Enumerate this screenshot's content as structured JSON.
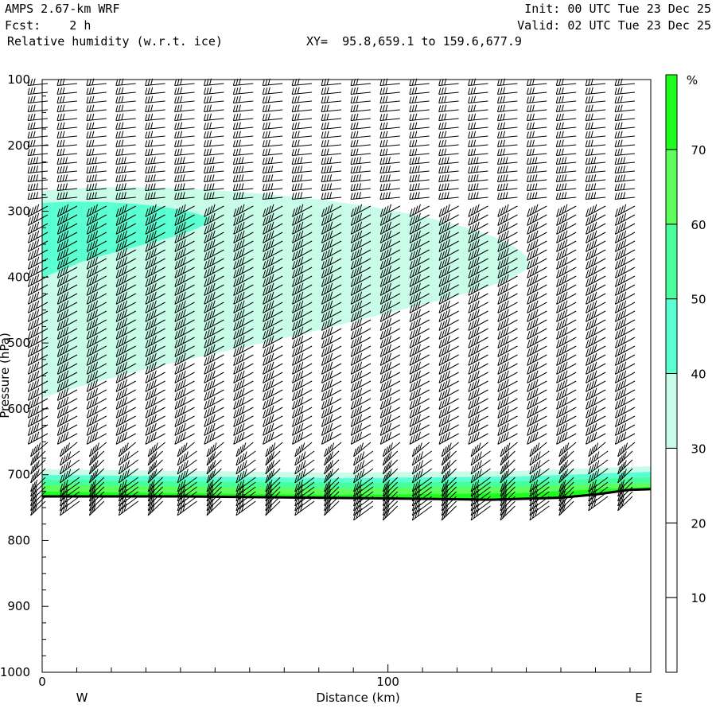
{
  "header": {
    "model": "AMPS 2.67-km WRF",
    "fcst": "Fcst:    2 h",
    "field": "Relative humidity (w.r.t. ice)",
    "xy": "XY=  95.8,659.1 to 159.6,677.9",
    "init": "Init: 00 UTC Tue 23 Dec 25",
    "valid": "Valid: 02 UTC Tue 23 Dec 25"
  },
  "chart_data": {
    "type": "heatmap",
    "title": "Relative humidity (w.r.t. ice)",
    "xlabel": "Distance (km)",
    "ylabel": "Pressure (hPa)",
    "xlim": [
      0,
      176
    ],
    "ylim": [
      1000,
      100
    ],
    "x_ticks": [
      "0",
      "100"
    ],
    "y_ticks": [
      "100",
      "200",
      "300",
      "400",
      "500",
      "600",
      "700",
      "800",
      "900",
      "1000"
    ],
    "x_end_labels": {
      "left": "W",
      "right": "E"
    },
    "colorbar": {
      "unit": "%",
      "levels": [
        "10",
        "20",
        "30",
        "40",
        "50",
        "60",
        "70"
      ],
      "colors": [
        "#ffffff",
        "#ffffff",
        "#ffffff",
        "#c8fce9",
        "#5affd2",
        "#48ff9c",
        "#5cff5c",
        "#1cff1c"
      ]
    },
    "overlay": "wind barbs",
    "terrain_pressure_hpa": [
      [
        0,
        733
      ],
      [
        40,
        733
      ],
      [
        100,
        736
      ],
      [
        130,
        738
      ],
      [
        150,
        735
      ],
      [
        160,
        730
      ],
      [
        170,
        723
      ],
      [
        176,
        722
      ]
    ]
  }
}
